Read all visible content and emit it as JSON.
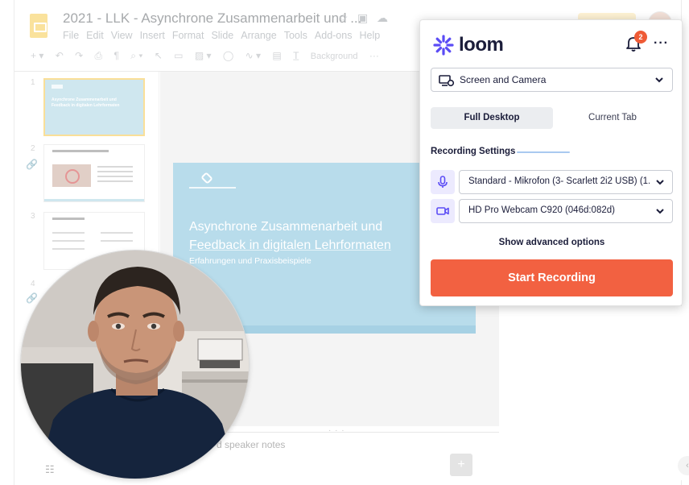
{
  "slides_app": {
    "doc_title": "2021 - LLK - Asynchrone Zusammenarbeit und ...",
    "menu": [
      "File",
      "Edit",
      "View",
      "Insert",
      "Format",
      "Slide",
      "Arrange",
      "Tools",
      "Add-ons",
      "Help"
    ],
    "toolbar_background_label": "Background",
    "filmstrip_numbers": [
      "1",
      "2",
      "3",
      "4"
    ],
    "slide_title_line1": "Asynchrone Zusammenarbeit und",
    "slide_title_line2": "Feedback in digitalen Lehrformaten",
    "slide_subtitle": "Erfahrungen und Praxisbeispiele",
    "notes_placeholder": "d speaker notes"
  },
  "loom": {
    "brand": "loom",
    "notification_count": "2",
    "more_label": "···",
    "mode": "Screen and Camera",
    "tabs": [
      "Full Desktop",
      "Current Tab"
    ],
    "active_tab": "Full Desktop",
    "recording_settings_label": "Recording Settings",
    "microphone": "Standard - Mikrofon (3- Scarlett 2i2 USB) (1...",
    "camera": "HD Pro Webcam C920 (046d:082d)",
    "advanced_options": "Show advanced options",
    "start_button": "Start Recording",
    "accent_color": "#f26141",
    "brand_color": "#5b4cf5"
  }
}
